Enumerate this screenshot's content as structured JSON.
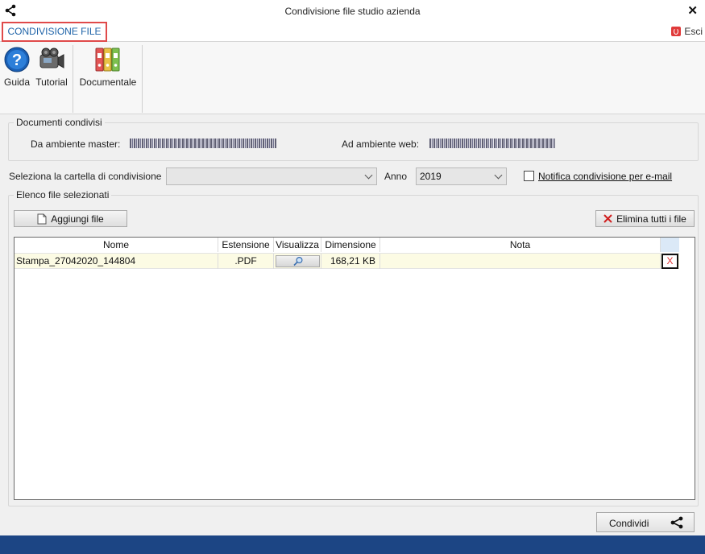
{
  "window": {
    "title": "Condivisione file studio azienda"
  },
  "ribbon": {
    "tab_label": "CONDIVISIONE FILE",
    "exit_label": "Esci",
    "buttons": {
      "guida": "Guida",
      "tutorial": "Tutorial",
      "documentale": "Documentale"
    }
  },
  "shared_docs": {
    "group_title": "Documenti condivisi",
    "master_label": "Da ambiente master:",
    "web_label": "Ad ambiente web:"
  },
  "folder": {
    "label": "Seleziona la cartella di condivisione",
    "value": ""
  },
  "year": {
    "label": "Anno",
    "value": "2019"
  },
  "notify": {
    "label": "Notifica condivisione per e-mail",
    "checked": false
  },
  "files": {
    "group_title": "Elenco file selezionati",
    "add_button": "Aggiungi file",
    "delete_all_button": "Elimina tutti i file",
    "columns": [
      "Nome",
      "Estensione",
      "Visualizza",
      "Dimensione",
      "Nota"
    ],
    "rows": [
      {
        "nome": "Stampa_27042020_144804",
        "estensione": ".PDF",
        "dimensione": "168,21 KB",
        "nota": "",
        "delete": "X"
      }
    ]
  },
  "actions": {
    "share_button": "Condividi"
  },
  "colors": {
    "accent": "#1e63a8",
    "footer": "#1c4584",
    "tab_border": "#e04a4a",
    "delete": "#e03030"
  },
  "icons": [
    "share-icon",
    "close-icon",
    "power-icon",
    "help-icon",
    "camera-icon",
    "binders-icon",
    "document-icon",
    "delete-icon",
    "magnifier-icon",
    "chevron-down-icon"
  ]
}
